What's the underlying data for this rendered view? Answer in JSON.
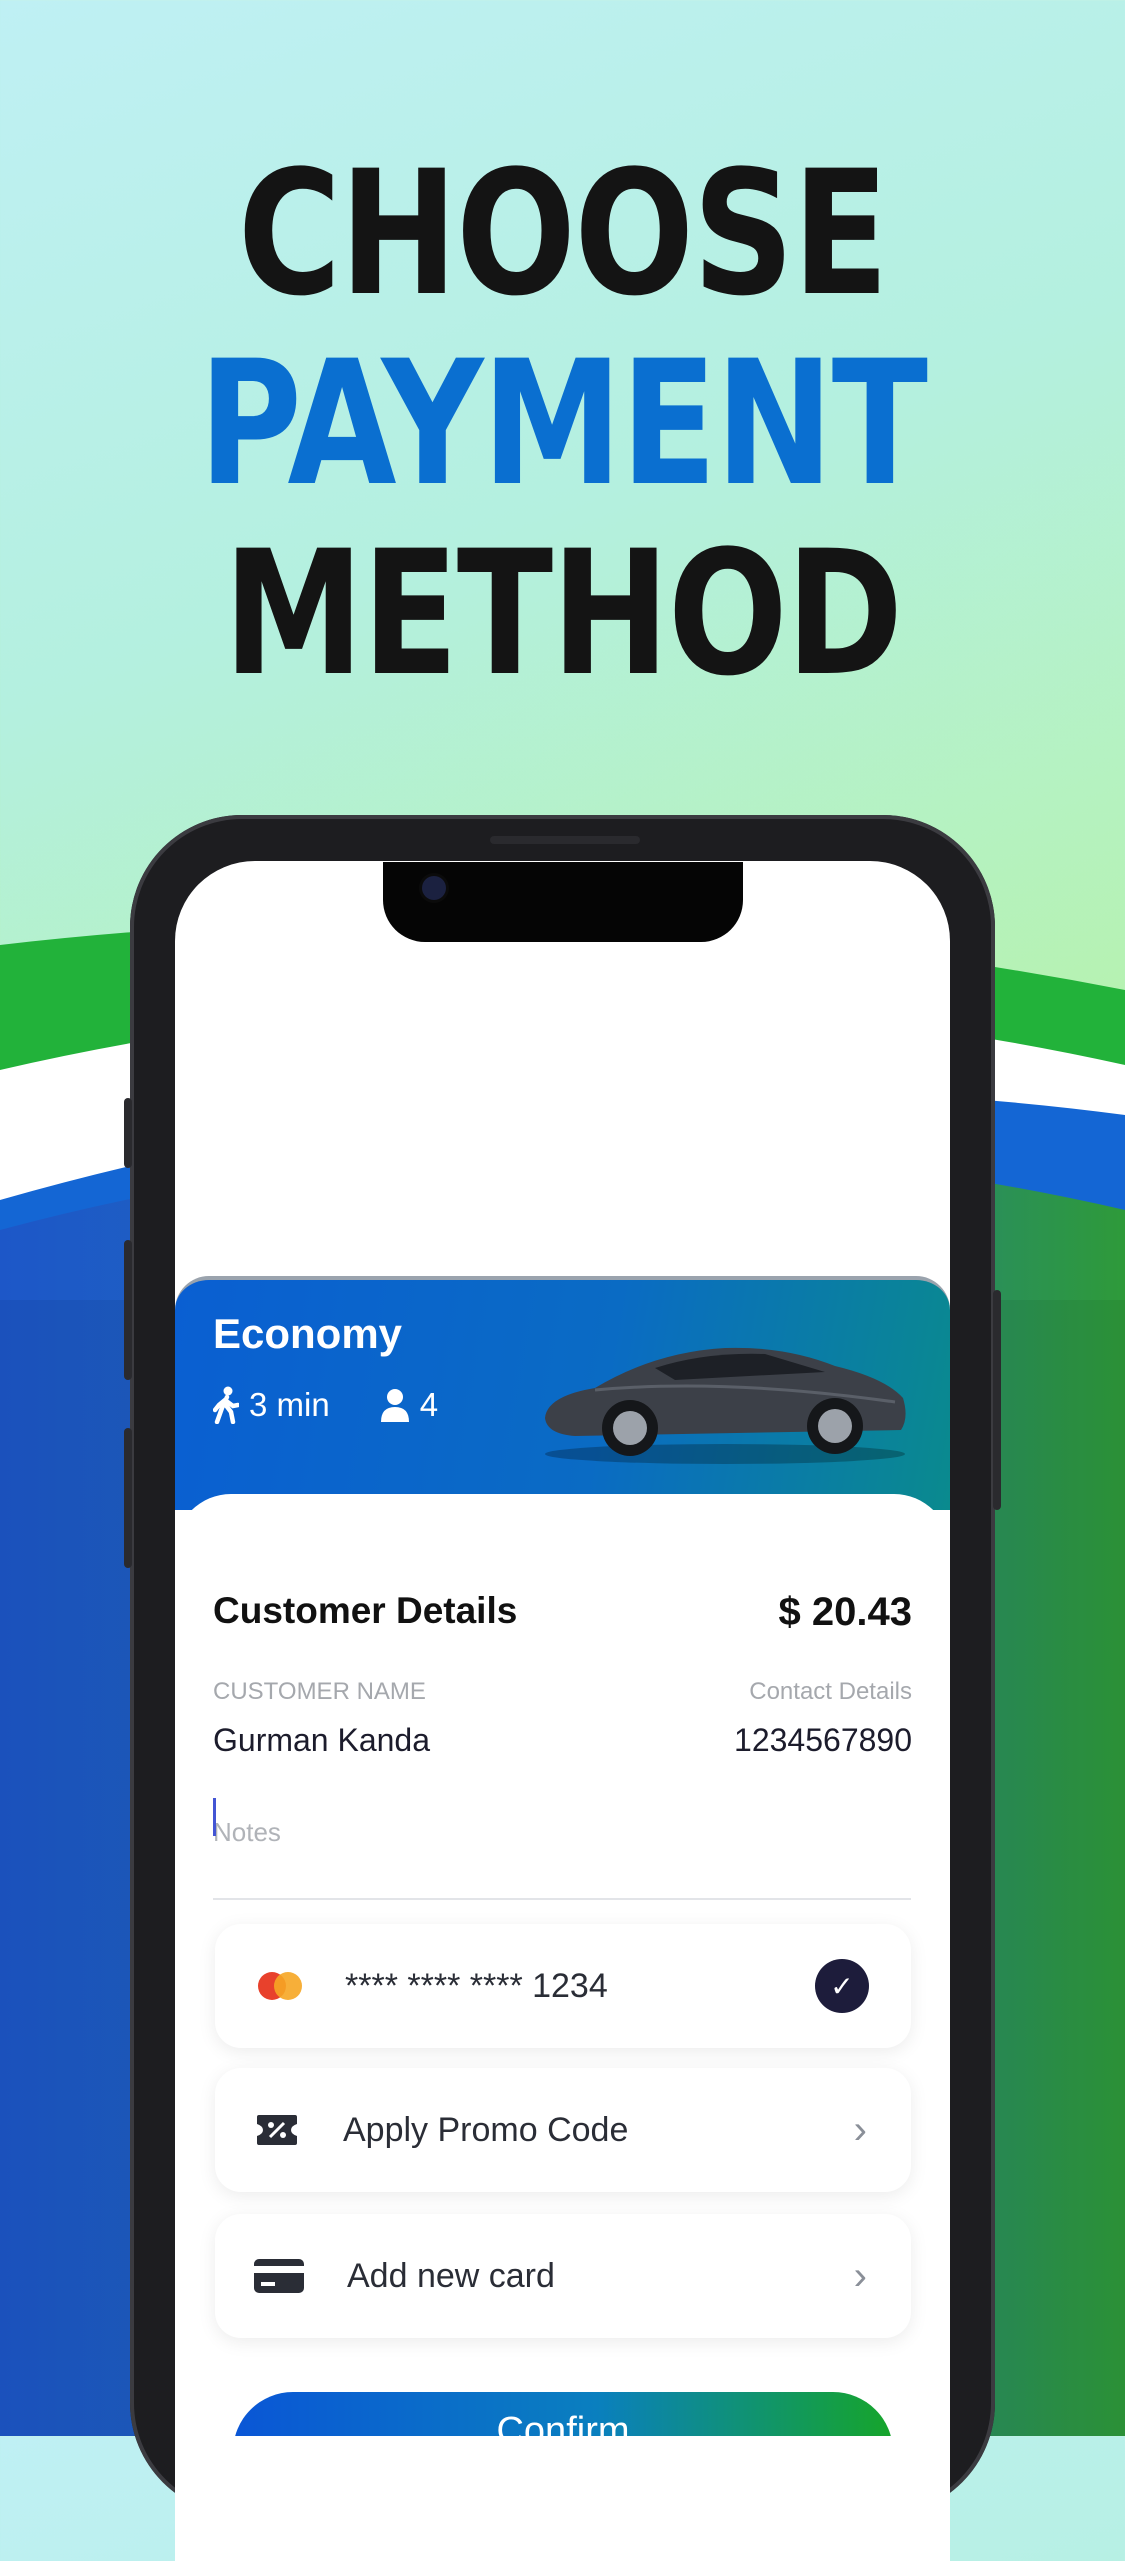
{
  "headline": {
    "line1": "CHOOSE",
    "line2": "PAYMENT",
    "line3": "METHOD"
  },
  "ride": {
    "title": "Economy",
    "eta": "3 min",
    "seats": "4",
    "icons": {
      "walk": "walking-person-icon",
      "seat": "person-icon"
    }
  },
  "customer": {
    "section_title": "Customer Details",
    "price": "$ 20.43",
    "name_label": "CUSTOMER NAME",
    "name_value": "Gurman Kanda",
    "contact_label": "Contact Details",
    "contact_value": "1234567890",
    "notes_placeholder": "Notes"
  },
  "payment": {
    "card_number": "**** **** **** 1234",
    "card_brand_icon": "mastercard-icon",
    "selected": true,
    "promo_label": "Apply Promo Code",
    "add_card_label": "Add new card"
  },
  "confirm_label": "Confirm",
  "colors": {
    "accent_blue": "#0a6fd0",
    "accent_green": "#16a52a",
    "dark": "#141414"
  }
}
